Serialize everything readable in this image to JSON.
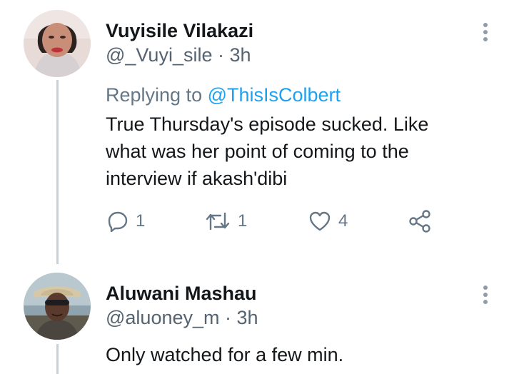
{
  "tweets": [
    {
      "name": "Vuyisile Vilakazi",
      "handle": "@_Vuyi_sile",
      "time": "3h",
      "replying_prefix": "Replying to ",
      "replying_to": "@ThisIsColbert",
      "text_lines": [
        "True Thursday's episode sucked. Like",
        "what was her point of coming to the",
        "interview if akash'dibi"
      ],
      "replies": "1",
      "retweets": "1",
      "likes": "4"
    },
    {
      "name": "Aluwani Mashau",
      "handle": "@aluoney_m",
      "time": "3h",
      "text": "Only watched for a few min."
    }
  ],
  "handle_separator": "·",
  "icons": {
    "reply": "reply-bubble-icon",
    "retweet": "retweet-icon",
    "like": "heart-icon",
    "share": "share-icon",
    "more": "more-vertical-icon"
  },
  "colors": {
    "text": "#14171a",
    "muted": "#657786",
    "mention": "#1da1f2",
    "thread_line": "#c9d1d8"
  }
}
